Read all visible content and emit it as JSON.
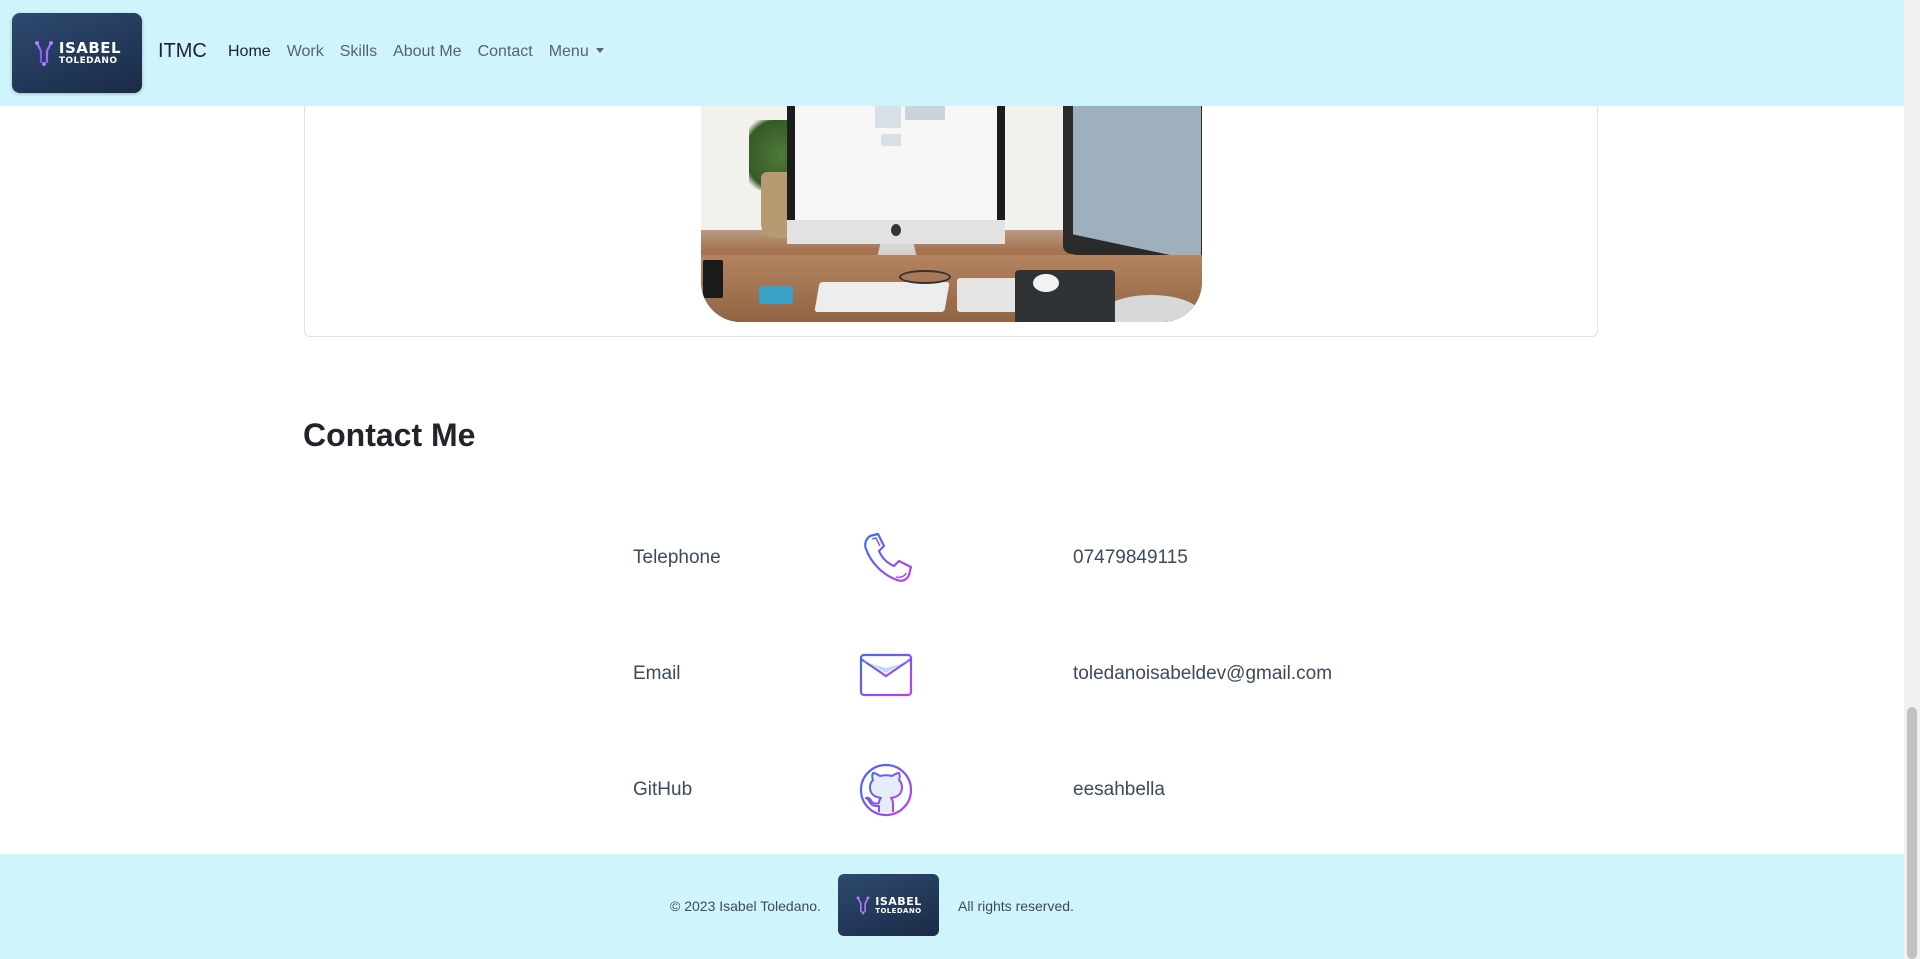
{
  "navbar": {
    "logo": {
      "line1": "ISABEL",
      "line2": "TOLEDANO"
    },
    "brand": "ITMC",
    "links": [
      {
        "label": "Home",
        "active": true
      },
      {
        "label": "Work",
        "active": false
      },
      {
        "label": "Skills",
        "active": false
      },
      {
        "label": "About Me",
        "active": false
      },
      {
        "label": "Contact",
        "active": false
      },
      {
        "label": "Menu",
        "active": false,
        "dropdown": true
      }
    ],
    "background": "#cff4fc"
  },
  "card": {
    "image": "desk-setup-photo"
  },
  "contact": {
    "title": "Contact Me",
    "rows": [
      {
        "label": "Telephone",
        "icon": "phone-icon",
        "value": "07479849115"
      },
      {
        "label": "Email",
        "icon": "envelope-icon",
        "value": "toledanoisabeldev@gmail.com"
      },
      {
        "label": "GitHub",
        "icon": "github-icon",
        "value": "eesahbella"
      }
    ]
  },
  "footer": {
    "copyright": "© 2023 Isabel Toledano.",
    "rights": "All rights reserved.",
    "logo": {
      "line1": "ISABEL",
      "line2": "TOLEDANO"
    }
  },
  "colors": {
    "accent_gradient_start": "#3b6cf6",
    "accent_gradient_end": "#c23df0",
    "logo_bg": "#1f3354"
  }
}
